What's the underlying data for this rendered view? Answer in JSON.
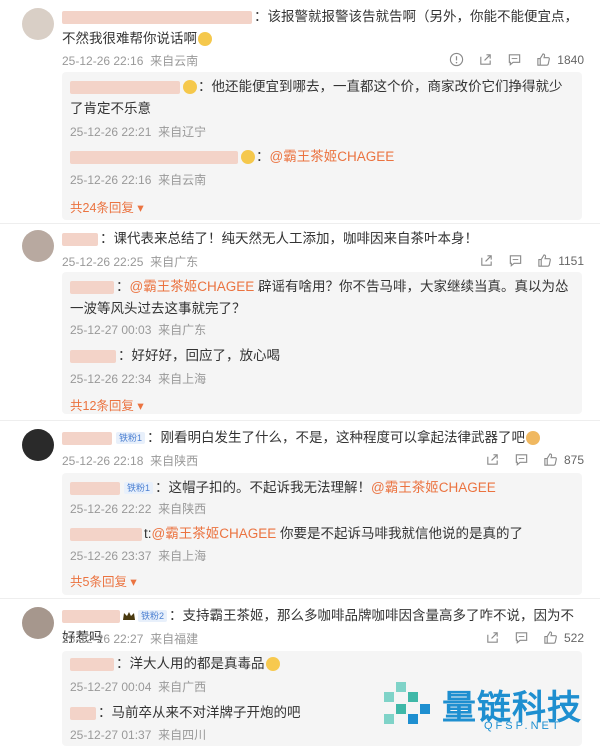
{
  "comments": [
    {
      "text": "：该报警就报警该告就告啊（另外，你能不能便宜点，不然我很难帮你说话啊",
      "time": "25-12-26 22:16",
      "location": "来自云南",
      "likes": "1840",
      "replies": [
        {
          "text": "：他还能便宜到哪去，一直都这个价，商家改价它们挣得就少了肯定不乐意",
          "time": "25-12-26 22:21",
          "location": "来自辽宁"
        },
        {
          "at": "@霸王茶姬CHAGEE",
          "text": "",
          "time": "25-12-26 22:16",
          "location": "来自云南"
        }
      ],
      "more": "共24条回复"
    },
    {
      "text": "：课代表来总结了！纯天然无人工添加，咖啡因来自茶叶本身！",
      "time": "25-12-26 22:25",
      "location": "来自广东",
      "likes": "1151",
      "replies": [
        {
          "at": "@霸王茶姬CHAGEE",
          "text": " 辟谣有啥用？你不告马啡，大家继续当真。真以为怂一波等风头过去这事就完了？",
          "time": "25-12-27 00:03",
          "location": "来自广东"
        },
        {
          "text": "：好好好，回应了，放心喝",
          "time": "25-12-26 22:34",
          "location": "来自上海"
        }
      ],
      "more": "共12条回复"
    },
    {
      "badge": "铁粉1",
      "text": "：刚看明白发生了什么，不是，这种程度可以拿起法律武器了吧",
      "time": "25-12-26 22:18",
      "location": "来自陕西",
      "likes": "875",
      "replies": [
        {
          "badge": "铁粉1",
          "text": "：这帽子扣的。不起诉我无法理解！",
          "at": "@霸王茶姬CHAGEE",
          "time": "25-12-26 22:22",
          "location": "来自陕西"
        },
        {
          "prefix": "t:",
          "at": "@霸王茶姬CHAGEE",
          "text": " 你要是不起诉马啡我就信他说的是真的了",
          "time": "25-12-26 23:37",
          "location": "来自上海"
        }
      ],
      "more": "共5条回复"
    },
    {
      "badge": "铁粉2",
      "text": "：支持霸王茶姬，那么多咖啡品牌咖啡因含量高多了咋不说，因为不好惹吗",
      "time": "25-12-26 22:27",
      "location": "来自福建",
      "likes": "522",
      "replies": [
        {
          "text": "：洋大人用的都是真毒品",
          "time": "25-12-27 00:04",
          "location": "来自广西"
        },
        {
          "text": "：马前卒从来不对洋牌子开炮的吧",
          "time": "25-12-27 01:37",
          "location": "来自四川"
        }
      ]
    }
  ],
  "icons": {
    "report": "warning-circle-icon",
    "share": "share-icon",
    "comment": "comment-icon",
    "like": "thumbs-up-icon"
  },
  "watermark": {
    "name": "量链科技",
    "url": "QFSP.NET"
  },
  "colors": {
    "accent": "#eb7340",
    "watermark": "#1e8fd0"
  }
}
